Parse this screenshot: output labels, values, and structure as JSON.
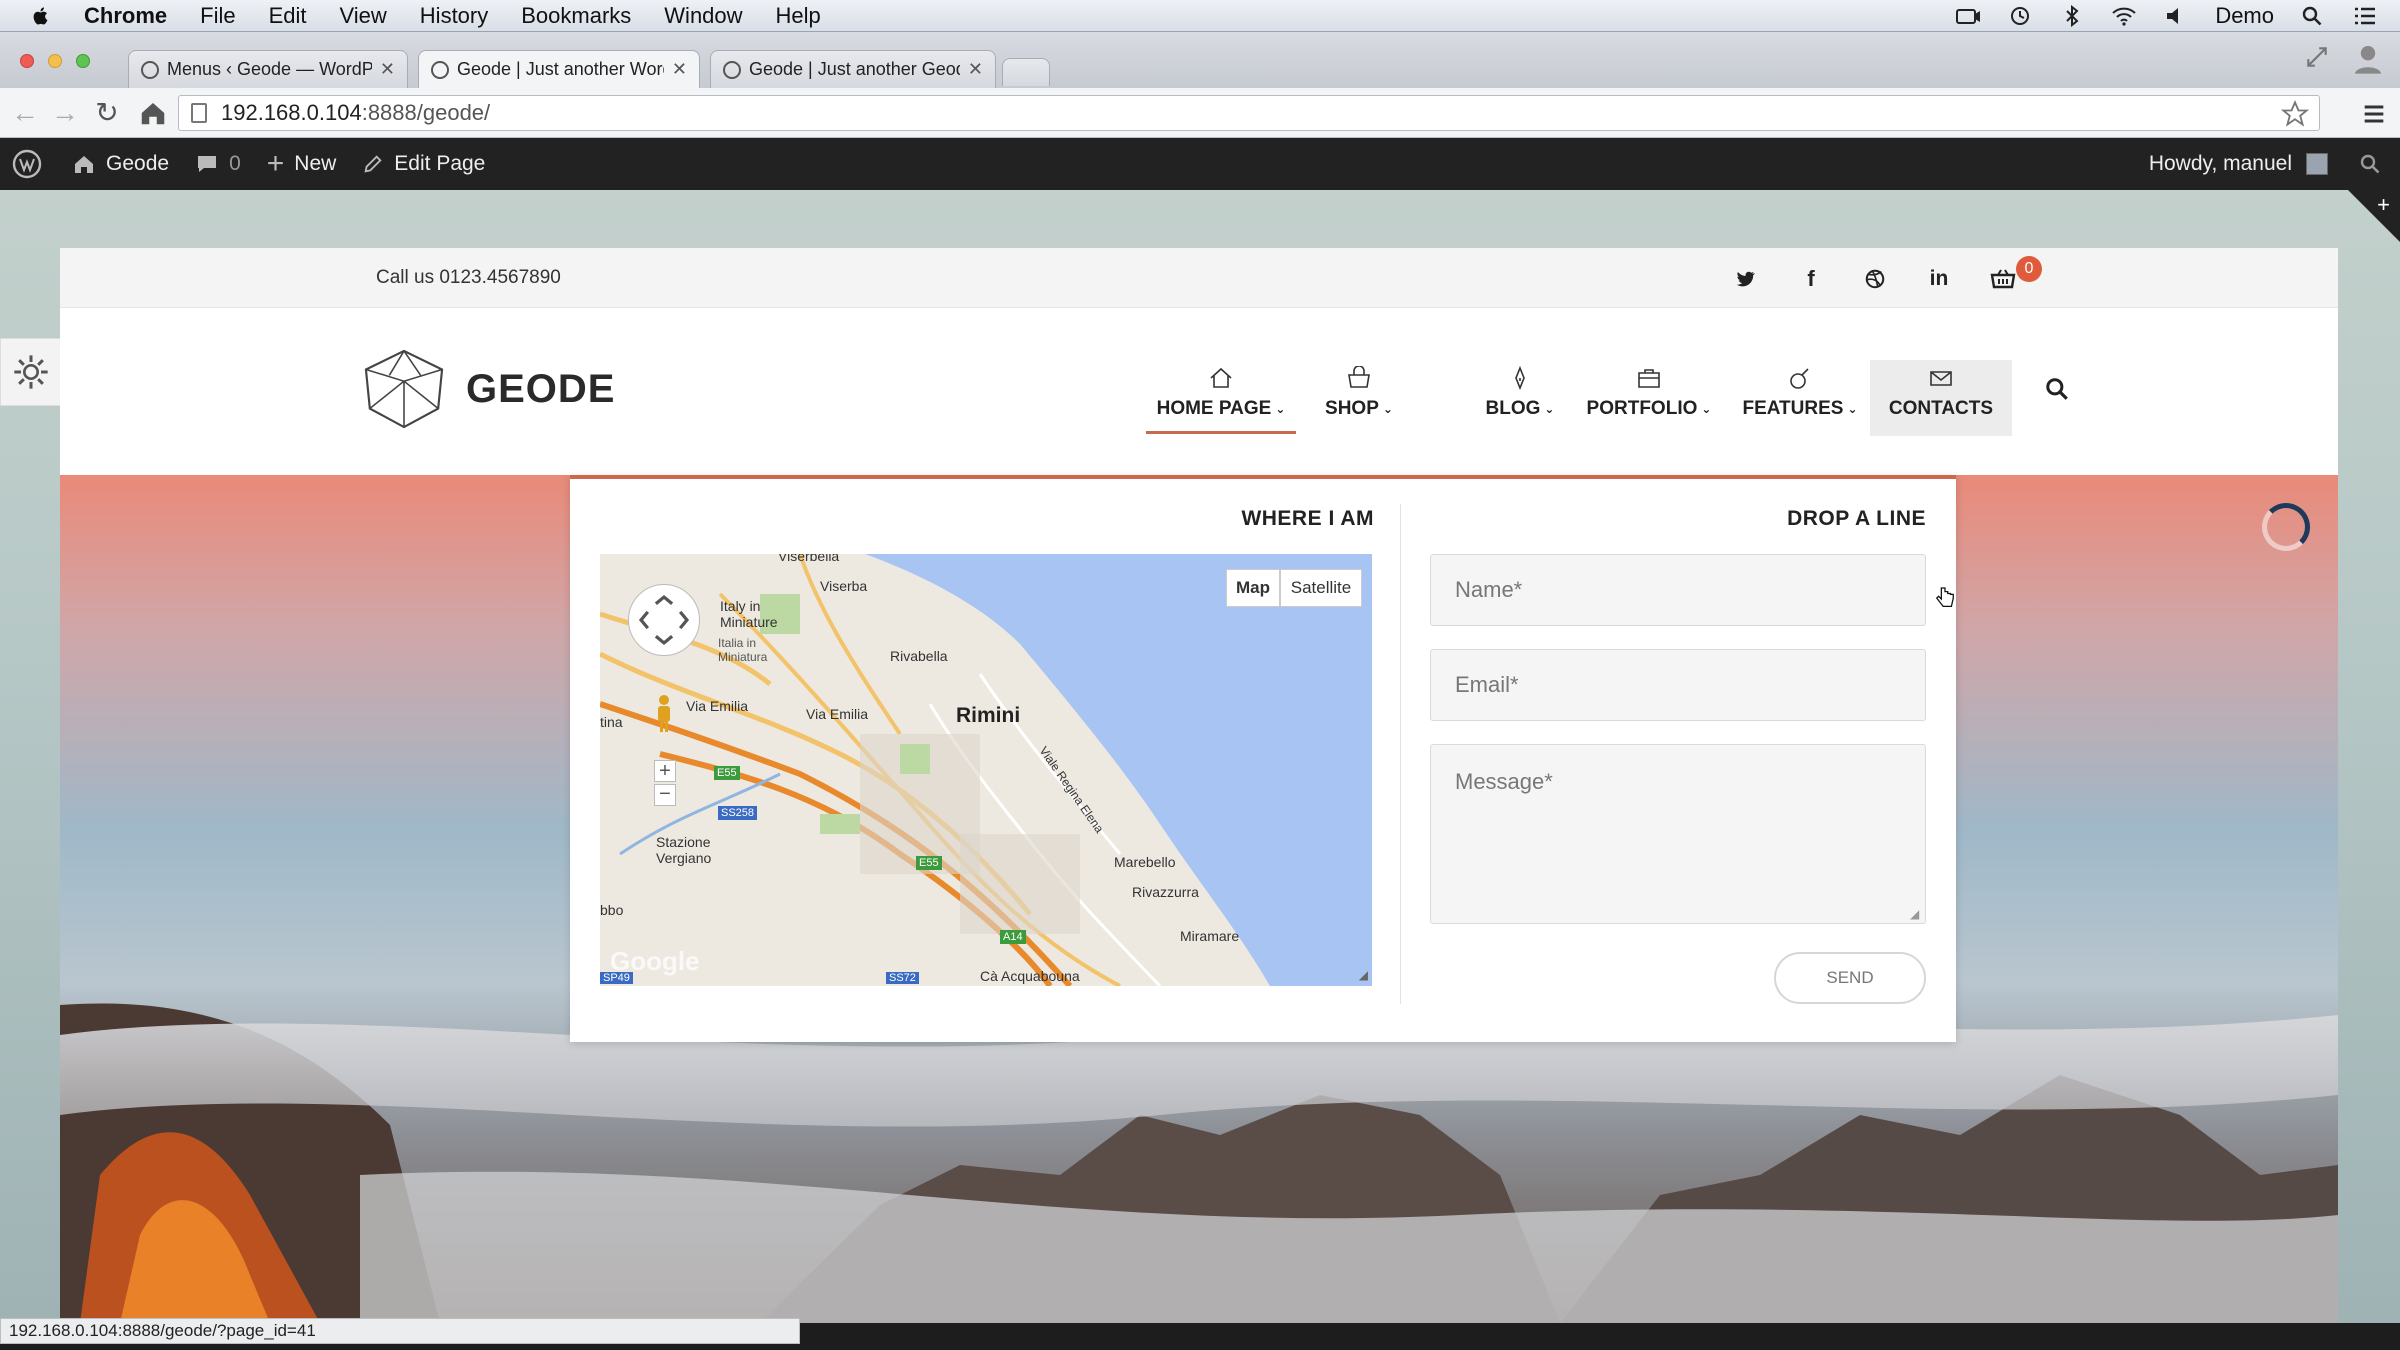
{
  "menubar": {
    "app": "Chrome",
    "items": [
      "File",
      "Edit",
      "View",
      "History",
      "Bookmarks",
      "Window",
      "Help"
    ],
    "user": "Demo"
  },
  "browser": {
    "tabs": [
      {
        "title": "Menus ‹ Geode — WordPre",
        "active": false
      },
      {
        "title": "Geode | Just another Word",
        "active": true
      },
      {
        "title": "Geode | Just another Geod",
        "active": false
      }
    ],
    "url_host": "192.168.0.104",
    "url_path": ":8888/geode/",
    "status_url": "192.168.0.104:8888/geode/?page_id=41"
  },
  "adminbar": {
    "site": "Geode",
    "comments": "0",
    "new": "New",
    "edit": "Edit Page",
    "howdy": "Howdy, manuel"
  },
  "site": {
    "call_us": "Call us 0123.4567890",
    "cart_count": "0",
    "logo": "GEODE",
    "nav": [
      {
        "label": "HOME PAGE",
        "icon": "home-icon"
      },
      {
        "label": "SHOP",
        "icon": "basket-icon"
      },
      {
        "label": "BLOG",
        "icon": "pen-icon"
      },
      {
        "label": "PORTFOLIO",
        "icon": "briefcase-icon"
      },
      {
        "label": "FEATURES",
        "icon": "bomb-icon"
      },
      {
        "label": "CONTACTS",
        "icon": "envelope-icon"
      }
    ]
  },
  "contact": {
    "where_heading": "WHERE I AM",
    "drop_heading": "DROP A LINE",
    "map_button": "Map",
    "satellite_button": "Satellite",
    "name_placeholder": "Name*",
    "email_placeholder": "Email*",
    "message_placeholder": "Message*",
    "send": "SEND"
  },
  "map": {
    "labels": [
      "Viserba",
      "Italy in Miniature",
      "Italia in Miniatura",
      "Rivabella",
      "Rimini",
      "Via Emilia",
      "Viale Regina Elena",
      "Stazione Vergiano",
      "Marebello",
      "Rivazzurra",
      "Miramare",
      "Cà Acquabouna",
      "Google",
      "E55",
      "SS258",
      "A14",
      "SP49",
      "SS72",
      "bbo",
      "tina",
      "Viserbella"
    ]
  },
  "colors": {
    "accent": "#c9694e",
    "adminbar": "#222222",
    "badge": "#e05a3c",
    "sea": "#a7c4f2"
  }
}
